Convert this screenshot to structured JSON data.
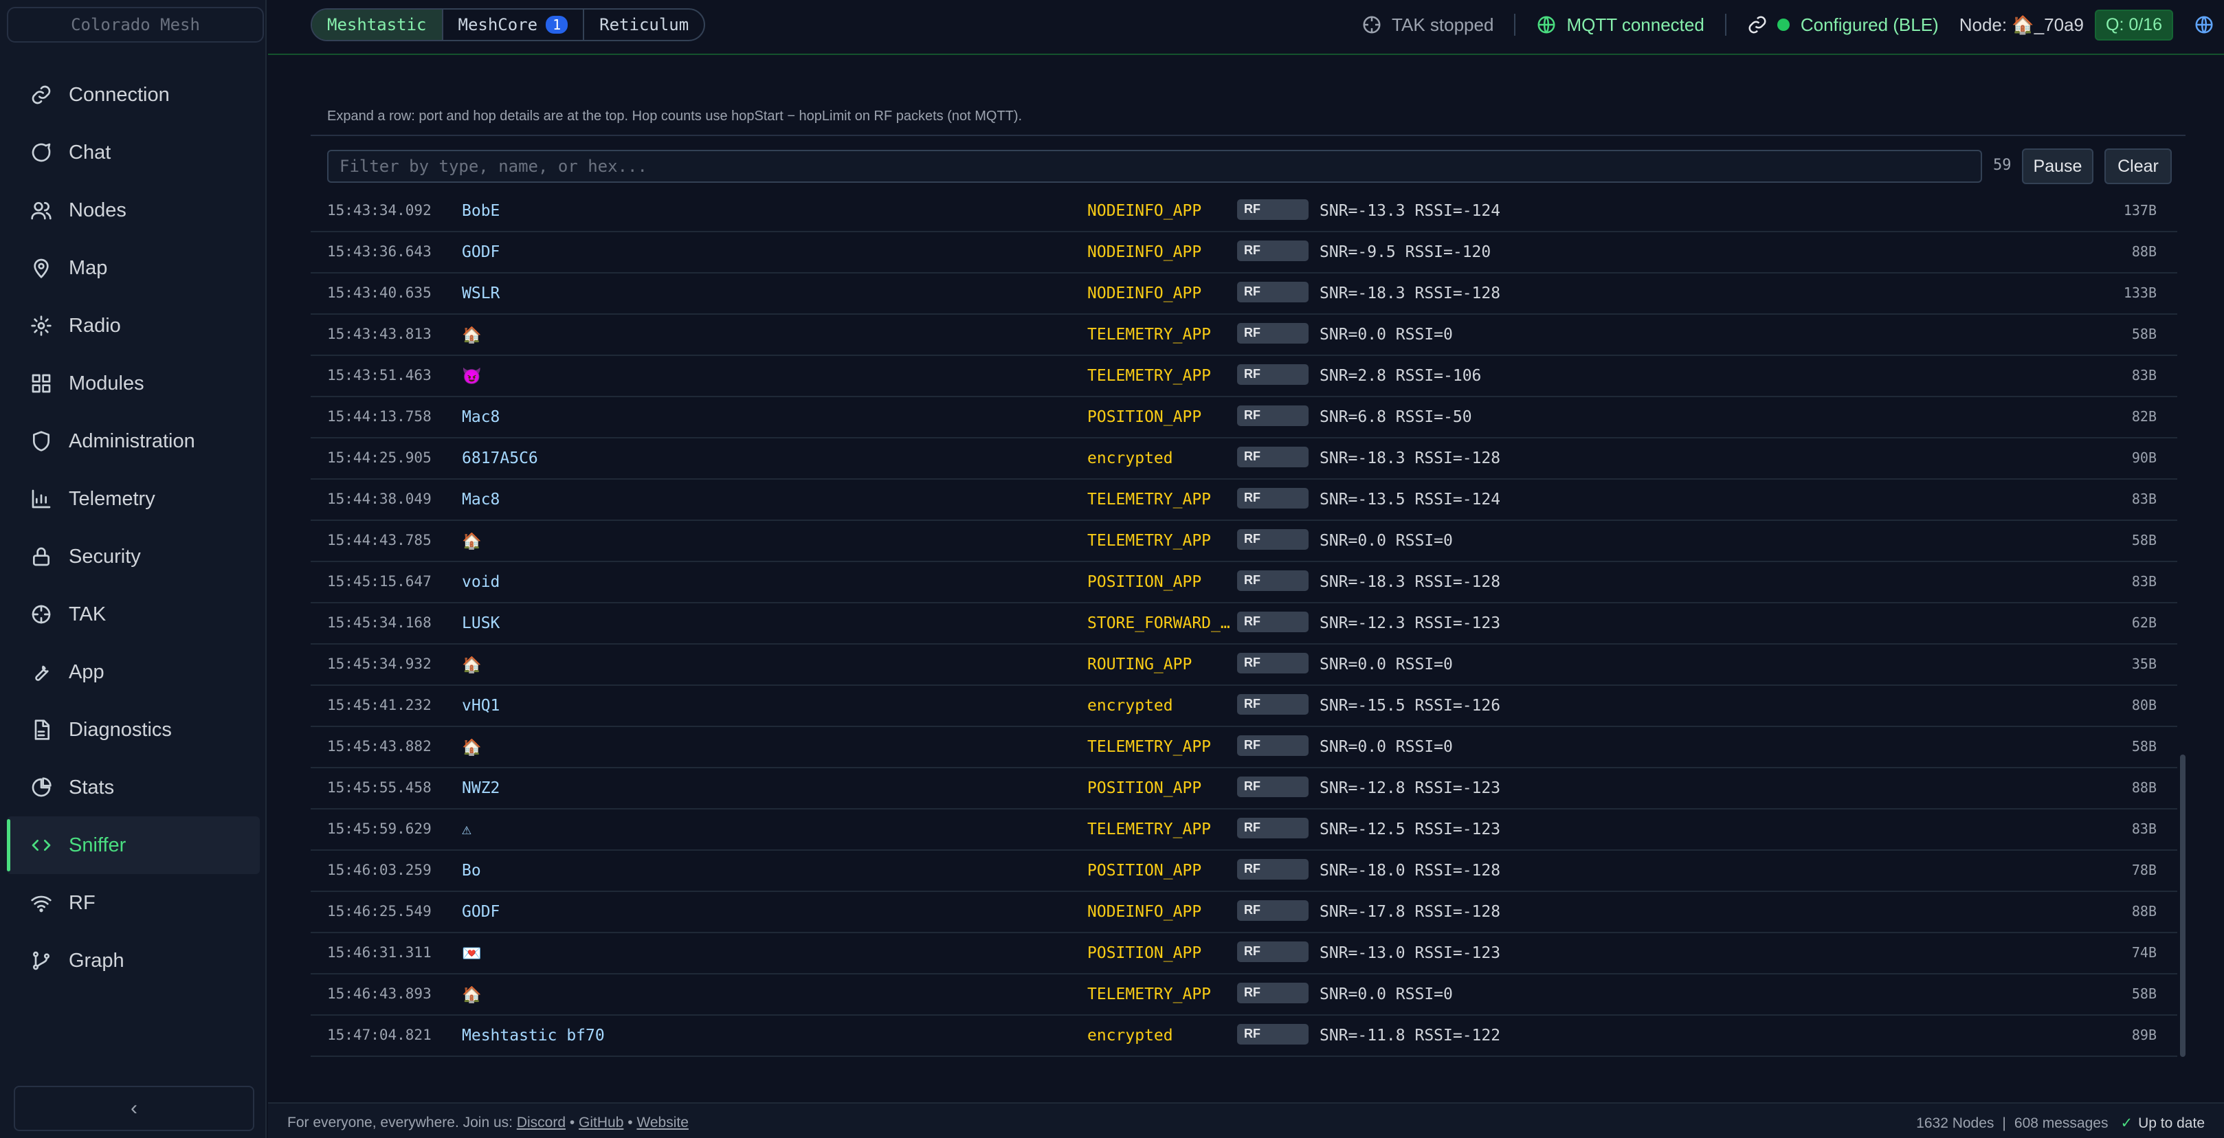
{
  "sidebar": {
    "brand": "Colorado Mesh",
    "items": [
      {
        "label": "Connection",
        "icon": "link-icon"
      },
      {
        "label": "Chat",
        "icon": "chat-icon"
      },
      {
        "label": "Nodes",
        "icon": "users-icon"
      },
      {
        "label": "Map",
        "icon": "map-pin-icon"
      },
      {
        "label": "Radio",
        "icon": "gear-icon"
      },
      {
        "label": "Modules",
        "icon": "modules-icon"
      },
      {
        "label": "Administration",
        "icon": "shield-icon"
      },
      {
        "label": "Telemetry",
        "icon": "chart-icon"
      },
      {
        "label": "Security",
        "icon": "lock-icon"
      },
      {
        "label": "TAK",
        "icon": "crosshair-icon"
      },
      {
        "label": "App",
        "icon": "wrench-icon"
      },
      {
        "label": "Diagnostics",
        "icon": "document-icon"
      },
      {
        "label": "Stats",
        "icon": "pie-icon"
      },
      {
        "label": "Sniffer",
        "icon": "code-icon",
        "active": true
      },
      {
        "label": "RF",
        "icon": "wifi-icon"
      },
      {
        "label": "Graph",
        "icon": "graph-icon"
      }
    ],
    "collapse_label": "‹"
  },
  "header": {
    "tabs": [
      {
        "label": "Meshtastic",
        "active": true
      },
      {
        "label": "MeshCore",
        "badge": "1"
      },
      {
        "label": "Reticulum"
      }
    ],
    "tak_status": "TAK stopped",
    "mqtt_status": "MQTT connected",
    "config_status": "Configured (BLE)",
    "node_label": "Node: 🏠_70a9",
    "queue": "Q: 0/16"
  },
  "sniffer": {
    "help_text": "Expand a row: port and hop details are at the top. Hop counts use hopStart − hopLimit on RF packets (not MQTT).",
    "filter_placeholder": "Filter by type, name, or hex...",
    "count": "59",
    "pause_label": "Pause",
    "clear_label": "Clear",
    "rows": [
      {
        "time": "15:43:34.092",
        "name": "BobE",
        "type": "NODEINFO_APP",
        "transport": "RF",
        "signal": "SNR=-13.3 RSSI=-124",
        "size": "137B"
      },
      {
        "time": "15:43:36.643",
        "name": "GODF",
        "type": "NODEINFO_APP",
        "transport": "RF",
        "signal": "SNR=-9.5 RSSI=-120",
        "size": "88B"
      },
      {
        "time": "15:43:40.635",
        "name": "WSLR",
        "type": "NODEINFO_APP",
        "transport": "RF",
        "signal": "SNR=-18.3 RSSI=-128",
        "size": "133B"
      },
      {
        "time": "15:43:43.813",
        "name": "🏠",
        "type": "TELEMETRY_APP",
        "transport": "RF",
        "signal": "SNR=0.0 RSSI=0",
        "size": "58B"
      },
      {
        "time": "15:43:51.463",
        "name": "😈",
        "type": "TELEMETRY_APP",
        "transport": "RF",
        "signal": "SNR=2.8 RSSI=-106",
        "size": "83B"
      },
      {
        "time": "15:44:13.758",
        "name": "Mac8",
        "type": "POSITION_APP",
        "transport": "RF",
        "signal": "SNR=6.8 RSSI=-50",
        "size": "82B"
      },
      {
        "time": "15:44:25.905",
        "name": "6817A5C6",
        "type": "encrypted",
        "transport": "RF",
        "signal": "SNR=-18.3 RSSI=-128",
        "size": "90B"
      },
      {
        "time": "15:44:38.049",
        "name": "Mac8",
        "type": "TELEMETRY_APP",
        "transport": "RF",
        "signal": "SNR=-13.5 RSSI=-124",
        "size": "83B"
      },
      {
        "time": "15:44:43.785",
        "name": "🏠",
        "type": "TELEMETRY_APP",
        "transport": "RF",
        "signal": "SNR=0.0 RSSI=0",
        "size": "58B"
      },
      {
        "time": "15:45:15.647",
        "name": "void",
        "type": "POSITION_APP",
        "transport": "RF",
        "signal": "SNR=-18.3 RSSI=-128",
        "size": "83B"
      },
      {
        "time": "15:45:34.168",
        "name": "LUSK",
        "type": "STORE_FORWARD_…",
        "transport": "RF",
        "signal": "SNR=-12.3 RSSI=-123",
        "size": "62B"
      },
      {
        "time": "15:45:34.932",
        "name": "🏠",
        "type": "ROUTING_APP",
        "transport": "RF",
        "signal": "SNR=0.0 RSSI=0",
        "size": "35B"
      },
      {
        "time": "15:45:41.232",
        "name": "vHQ1",
        "type": "encrypted",
        "transport": "RF",
        "signal": "SNR=-15.5 RSSI=-126",
        "size": "80B"
      },
      {
        "time": "15:45:43.882",
        "name": "🏠",
        "type": "TELEMETRY_APP",
        "transport": "RF",
        "signal": "SNR=0.0 RSSI=0",
        "size": "58B"
      },
      {
        "time": "15:45:55.458",
        "name": "NWZ2",
        "type": "POSITION_APP",
        "transport": "RF",
        "signal": "SNR=-12.8 RSSI=-123",
        "size": "88B"
      },
      {
        "time": "15:45:59.629",
        "name": "⚠",
        "type": "TELEMETRY_APP",
        "transport": "RF",
        "signal": "SNR=-12.5 RSSI=-123",
        "size": "83B"
      },
      {
        "time": "15:46:03.259",
        "name": "Bo",
        "type": "POSITION_APP",
        "transport": "RF",
        "signal": "SNR=-18.0 RSSI=-128",
        "size": "78B"
      },
      {
        "time": "15:46:25.549",
        "name": "GODF",
        "type": "NODEINFO_APP",
        "transport": "RF",
        "signal": "SNR=-17.8 RSSI=-128",
        "size": "88B"
      },
      {
        "time": "15:46:31.311",
        "name": "💌",
        "type": "POSITION_APP",
        "transport": "RF",
        "signal": "SNR=-13.0 RSSI=-123",
        "size": "74B"
      },
      {
        "time": "15:46:43.893",
        "name": "🏠",
        "type": "TELEMETRY_APP",
        "transport": "RF",
        "signal": "SNR=0.0 RSSI=0",
        "size": "58B"
      },
      {
        "time": "15:47:04.821",
        "name": "Meshtastic bf70",
        "type": "encrypted",
        "transport": "RF",
        "signal": "SNR=-11.8 RSSI=-122",
        "size": "89B"
      }
    ]
  },
  "footer": {
    "tagline": "For everyone, everywhere. Join us:",
    "links": [
      "Discord",
      "GitHub",
      "Website"
    ],
    "nodes": "1632 Nodes",
    "messages": "608 messages",
    "update_status": "Up to date"
  },
  "colors": {
    "accent": "#4ade80",
    "type_text": "#facc15",
    "name_text": "#a5d8ff"
  }
}
